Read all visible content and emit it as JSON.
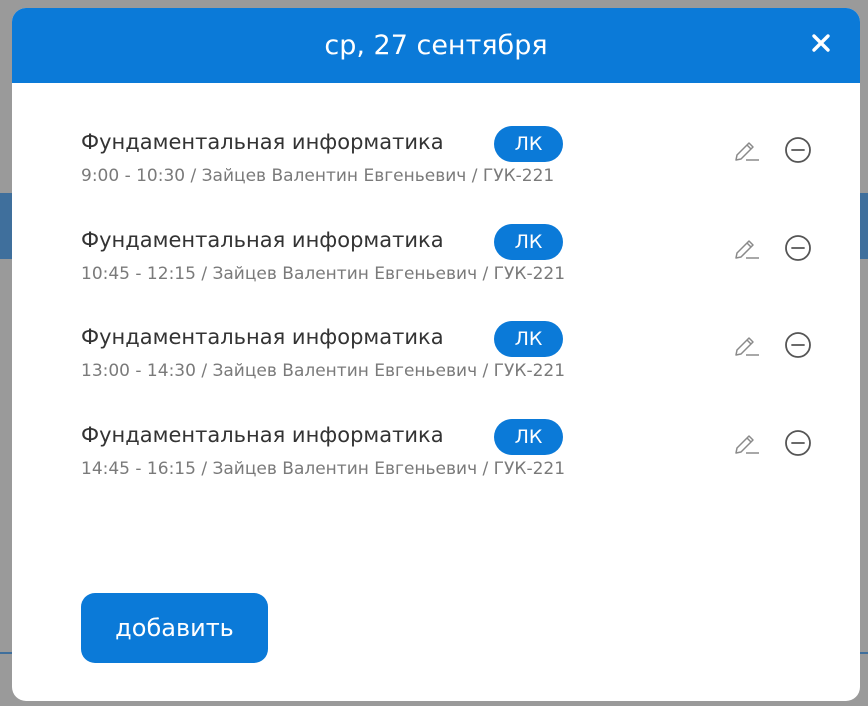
{
  "modal": {
    "title": "ср, 27 сентября",
    "close_icon": "close-icon",
    "lessons": [
      {
        "title": "Фундаментальная информатика",
        "type": "ЛК",
        "meta": "9:00 - 10:30 / Зайцев Валентин Евгеньевич / ГУК-221"
      },
      {
        "title": "Фундаментальная информатика",
        "type": "ЛК",
        "meta": "10:45 - 12:15 / Зайцев Валентин Евгеньевич / ГУК-221"
      },
      {
        "title": "Фундаментальная информатика",
        "type": "ЛК",
        "meta": "13:00 - 14:30 / Зайцев Валентин Евгеньевич / ГУК-221"
      },
      {
        "title": "Фундаментальная информатика",
        "type": "ЛК",
        "meta": "14:45 - 16:15 / Зайцев Валентин Евгеньевич / ГУК-221"
      }
    ],
    "add_label": "добавить"
  },
  "colors": {
    "accent": "#0b7ad8",
    "title_text": "#333333",
    "meta_text": "#7a7a7a",
    "icon": "#8a8a8a"
  }
}
